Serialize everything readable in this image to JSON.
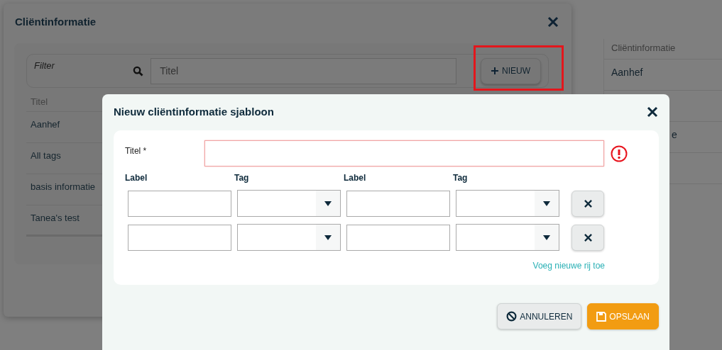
{
  "background_page": {
    "column_header": "Cliëntinformatie",
    "rows": [
      {
        "cell": "Aanhef"
      },
      {},
      {
        "cell": "e"
      },
      {}
    ]
  },
  "list_dialog": {
    "title": "Cliëntinformatie",
    "filter": {
      "label": "Filter",
      "placeholder": "Titel"
    },
    "new_button": {
      "label": "NIEUW",
      "highlighted": true
    },
    "table": {
      "column": "Titel",
      "rows": [
        "Aanhef",
        "All tags",
        "basis informatie",
        "Tanea's test"
      ]
    }
  },
  "template_dialog": {
    "title": "Nieuw cliëntinformatie sjabloon",
    "title_field": {
      "label": "Titel *",
      "invalid": true
    },
    "columns": [
      "Label",
      "Tag",
      "Label",
      "Tag"
    ],
    "rows": [
      {
        "kind": "mapping"
      },
      {
        "kind": "mapping"
      }
    ],
    "add_link": "Voeg nieuwe rij toe",
    "buttons": [
      {
        "label": "ANNULEREN",
        "kind": "cancel"
      },
      {
        "label": "OPSLAAN",
        "kind": "save"
      }
    ]
  }
}
